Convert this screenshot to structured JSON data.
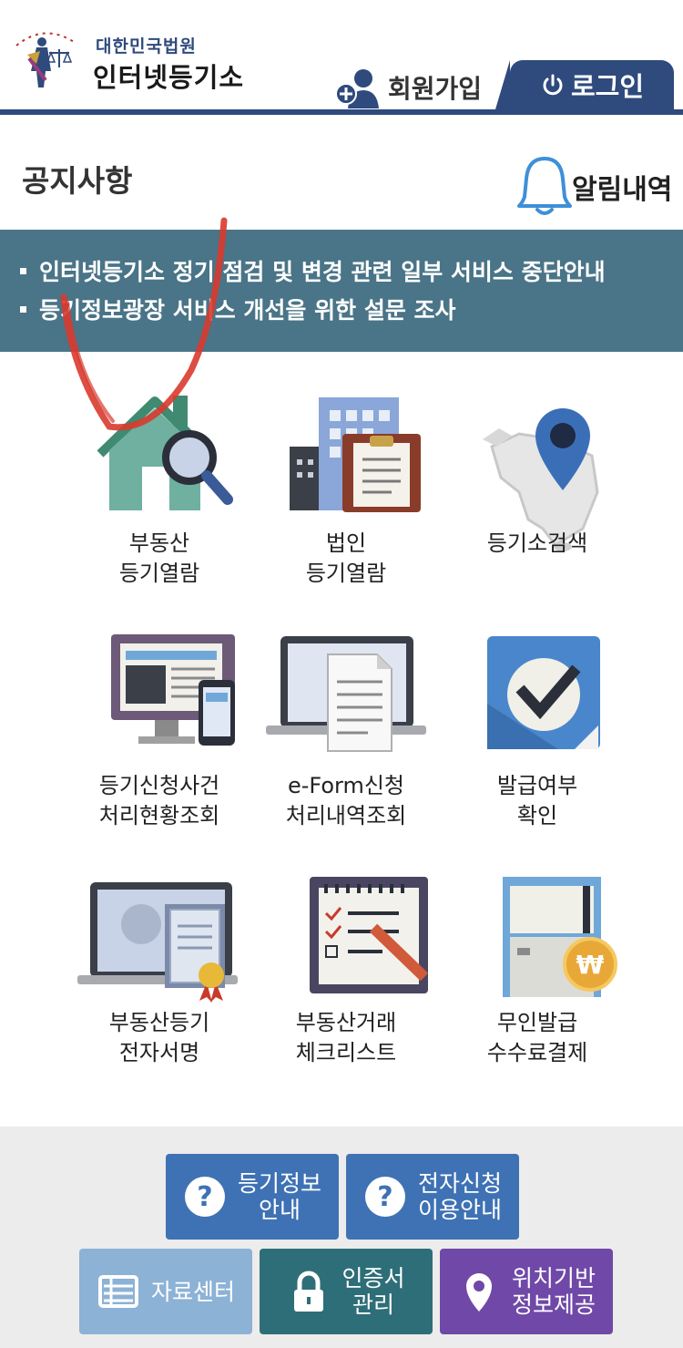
{
  "header": {
    "logo_sub": "대한민국법원",
    "logo_main": "인터넷등기소",
    "join_label": "회원가입",
    "login_label": "로그인",
    "icons": {
      "logo": "court-logo-icon",
      "join": "user-add-icon",
      "login": "power-icon"
    }
  },
  "notice": {
    "title": "공지사항",
    "alarm_label": "알림내역",
    "items": [
      "인터넷등기소 정기 점검 및 변경 관련 일부 서비스 중단안내",
      "등기정보광장 서비스 개선을 위한 설문 조사"
    ]
  },
  "menu": [
    {
      "line1": "부동산",
      "line2": "등기열람",
      "icon": "house-search-icon"
    },
    {
      "line1": "법인",
      "line2": "등기열람",
      "icon": "building-document-icon"
    },
    {
      "line1": "",
      "line2": "등기소검색",
      "icon": "map-pin-icon"
    },
    {
      "line1": "등기신청사건",
      "line2": "처리현황조회",
      "icon": "monitor-mobile-icon"
    },
    {
      "line1": "e-Form신청",
      "line2": "처리내역조회",
      "icon": "laptop-document-icon"
    },
    {
      "line1": "발급여부",
      "line2": "확인",
      "icon": "check-circle-icon"
    },
    {
      "line1": "부동산등기",
      "line2": "전자서명",
      "icon": "laptop-certificate-icon"
    },
    {
      "line1": "부동산거래",
      "line2": "체크리스트",
      "icon": "checklist-icon"
    },
    {
      "line1": "무인발급",
      "line2": "수수료결제",
      "icon": "kiosk-coin-icon"
    }
  ],
  "bottom_buttons": [
    {
      "line1": "등기정보",
      "line2": "안내",
      "icon": "question-icon"
    },
    {
      "line1": "전자신청",
      "line2": "이용안내",
      "icon": "question-icon"
    },
    {
      "line1": "자료센터",
      "line2": "",
      "icon": "list-icon"
    },
    {
      "line1": "인증서",
      "line2": "관리",
      "icon": "lock-icon"
    },
    {
      "line1": "위치기반",
      "line2": "정보제공",
      "icon": "location-pin-icon"
    }
  ],
  "colors": {
    "brand_navy": "#2f4a7c",
    "notice_bg": "#4a7487",
    "btn_blue": "#3f72b4",
    "btn_light": "#8cb2d6",
    "btn_teal": "#2e6e78",
    "btn_purple": "#7048a8"
  }
}
